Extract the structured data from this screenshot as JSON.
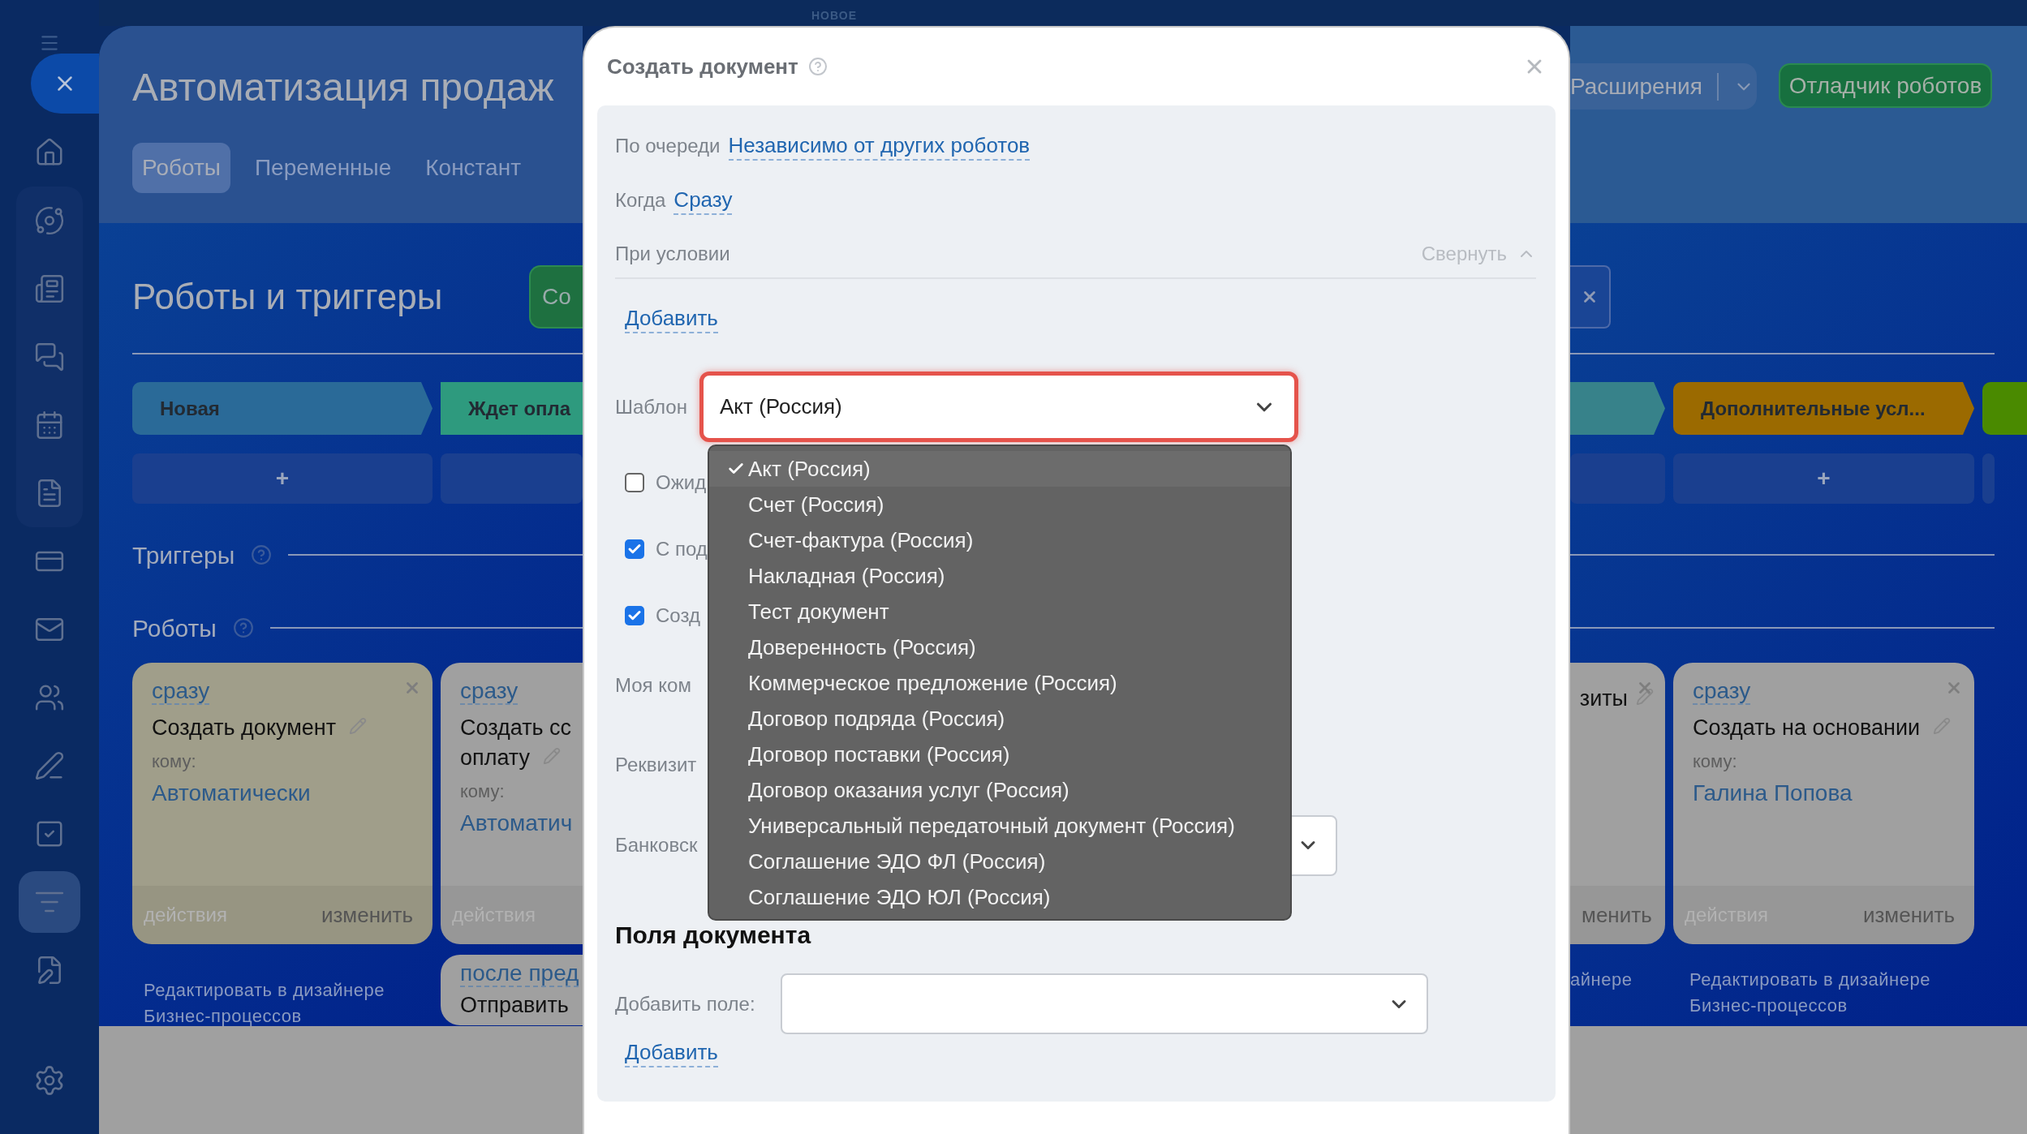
{
  "top_bar": {
    "badge": "НОВОЕ"
  },
  "sidebar": {
    "items": [
      {
        "selected": false
      },
      {
        "selected": false
      },
      {
        "selected": false
      },
      {
        "selected": false
      },
      {
        "selected": false
      },
      {
        "selected": false
      },
      {
        "selected": false
      },
      {
        "selected": false
      },
      {
        "selected": false
      },
      {
        "selected": false
      },
      {
        "selected": false
      },
      {
        "selected": true
      },
      {
        "selected": false
      }
    ]
  },
  "header": {
    "title": "Автоматизация продаж",
    "tabs": [
      {
        "label": "Роботы",
        "selected": true
      },
      {
        "label": "Переменные",
        "selected": false
      },
      {
        "label": "Констант",
        "selected": false
      }
    ],
    "extensions_button": "Расширения",
    "debugger_button": "Отладчик роботов"
  },
  "section": {
    "title": "Роботы и триггеры",
    "create_button": "Со"
  },
  "stages_left": [
    {
      "name": "Новая",
      "color": "#2a6a98",
      "add": "+"
    },
    {
      "name": "Ждет опла",
      "color": "#2e9a7e"
    }
  ],
  "stages_right": [
    {
      "color": "#37828a"
    },
    {
      "name": "Дополнительные усл...",
      "color": "#9b6a00",
      "add": "+"
    },
    {
      "color": "#4a8a00"
    }
  ],
  "triggers_heading": "Триггеры",
  "robots_heading": "Роботы",
  "robots_left": [
    {
      "cards": [
        {
          "when": "сразу",
          "action": [
            "Создать документ"
          ],
          "to_label": "кому:",
          "to": "Автоматически",
          "actions_label": "действия",
          "edit_label": "изменить",
          "color": "#a09e8a",
          "closable": true,
          "editable": true
        }
      ],
      "note": "Редактировать в дизайнере Бизнес-процессов"
    },
    {
      "cards": [
        {
          "when": "сразу",
          "action": [
            "Создать сс",
            "оплату"
          ],
          "to_label": "кому:",
          "to": "Автоматич",
          "actions_label": "действия",
          "color": "#a0a0a0",
          "closable": false,
          "editable": true
        },
        {
          "when": "после пред",
          "action": [
            "Отправить"
          ],
          "color": "#a0a0a0",
          "closable": false,
          "editable": false
        }
      ]
    }
  ],
  "robots_right": [
    {
      "kind": "tail",
      "action": [
        "зиты"
      ],
      "edit_label": "менить",
      "color": "#a0a0a0",
      "closable": true,
      "editable": true,
      "note": "айнере"
    },
    {
      "kind": "full",
      "when": "сразу",
      "action": [
        "Создать на основании"
      ],
      "to_label": "кому:",
      "to": "Галина Попова",
      "actions_label": "действия",
      "edit_label": "изменить",
      "color": "#a0a0a0",
      "closable": true,
      "editable": true,
      "note": "Редактировать в дизайнере Бизнес-процессов"
    }
  ],
  "modal": {
    "title": "Создать документ",
    "queue_label": "По очереди",
    "queue_value": "Независимо от других роботов",
    "when_label": "Когда",
    "when_value": "Сразу",
    "condition_label": "При условии",
    "collapse_label": "Свернуть",
    "add_condition": "Добавить",
    "template": {
      "label": "Шаблон",
      "value": "Акт (Россия)",
      "expanded": true,
      "options": [
        {
          "label": "Акт (Россия)",
          "selected": true
        },
        {
          "label": "Счет (Россия)",
          "selected": false
        },
        {
          "label": "Счет-фактура (Россия)",
          "selected": false
        },
        {
          "label": "Накладная (Россия)",
          "selected": false
        },
        {
          "label": "Тест документ",
          "selected": false
        },
        {
          "label": "Доверенность (Россия)",
          "selected": false
        },
        {
          "label": "Коммерческое предложение (Россия)",
          "selected": false
        },
        {
          "label": "Договор подряда (Россия)",
          "selected": false
        },
        {
          "label": "Договор поставки (Россия)",
          "selected": false
        },
        {
          "label": "Договор оказания услуг (Россия)",
          "selected": false
        },
        {
          "label": "Универсальный передаточный документ (Россия)",
          "selected": false
        },
        {
          "label": "Соглашение ЭДО ФЛ (Россия)",
          "selected": false
        },
        {
          "label": "Соглашение ЭДО ЮЛ (Россия)",
          "selected": false
        }
      ]
    },
    "checkboxes": [
      {
        "label": "Ожид",
        "checked": false
      },
      {
        "label": "С под",
        "checked": true
      },
      {
        "label": "Созд",
        "checked": true
      }
    ],
    "company_label": "Моя ком",
    "requisites_label": "Реквизит",
    "bank_label": "Банковск",
    "fields_heading": "Поля документа",
    "add_field_label": "Добавить поле:",
    "add_field_link": "Добавить"
  }
}
